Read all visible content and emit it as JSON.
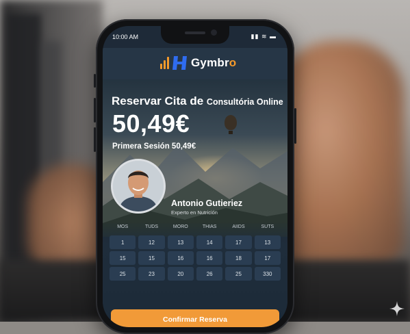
{
  "status": {
    "time": "10:00 AM",
    "icons": "signal-icon wifi-icon battery-icon"
  },
  "brand": {
    "name_main": "Gymbr",
    "name_accent": "o"
  },
  "booking": {
    "title": "Reservar Cita de",
    "title_service": "Consultória Online",
    "price": "50,49€",
    "first_session": "Primera Sesión 50,49€"
  },
  "expert": {
    "name": "Antonio Gutieriez",
    "role": "Experto en Nutrición"
  },
  "calendar": {
    "days": [
      "MOS",
      "TUDS",
      "MORO",
      "THIAS",
      "AIIDS",
      "SUTS"
    ],
    "dates": [
      [
        "1",
        "12",
        "13",
        "14",
        "17",
        "13"
      ],
      [
        "15",
        "15",
        "16",
        "16",
        "18",
        "17"
      ],
      [
        "25",
        "23",
        "20",
        "26",
        "25",
        "330"
      ]
    ]
  },
  "cta": {
    "label": "Confirmar Reserva"
  },
  "colors": {
    "accent": "#f19a38",
    "brand_blue": "#2f6cf0",
    "screen_bg": "#1e2a38"
  }
}
